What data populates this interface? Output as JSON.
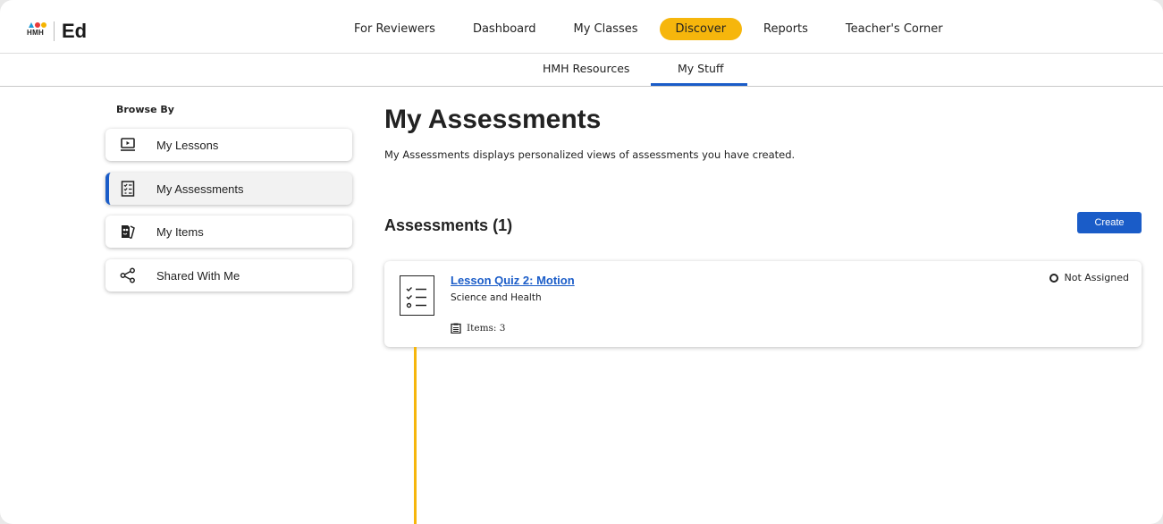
{
  "brand": {
    "logo_text": "HMH",
    "app_name": "Ed"
  },
  "nav": {
    "items": [
      "For Reviewers",
      "Dashboard",
      "My Classes",
      "Discover",
      "Reports",
      "Teacher's Corner"
    ],
    "active": "Discover",
    "accent_color": "#f6b60c"
  },
  "subnav": {
    "tabs": [
      "HMH Resources",
      "My Stuff"
    ],
    "active": "My Stuff"
  },
  "sidebar": {
    "heading": "Browse By",
    "items": [
      {
        "label": "My Lessons",
        "icon": "play-screen-icon"
      },
      {
        "label": "My Assessments",
        "icon": "checklist-icon",
        "selected": true
      },
      {
        "label": "My Items",
        "icon": "items-icon"
      },
      {
        "label": "Shared With Me",
        "icon": "share-icon"
      }
    ]
  },
  "main": {
    "title": "My Assessments",
    "description": "My Assessments displays personalized views of assessments you have created.",
    "section_title": "Assessments (1)",
    "create_label": "Create",
    "primary_color": "#1a5cc8"
  },
  "assessments": [
    {
      "title": "Lesson Quiz 2: Motion",
      "subject": "Science and Health",
      "items_label": "Items: 3",
      "status": "Not Assigned"
    }
  ]
}
